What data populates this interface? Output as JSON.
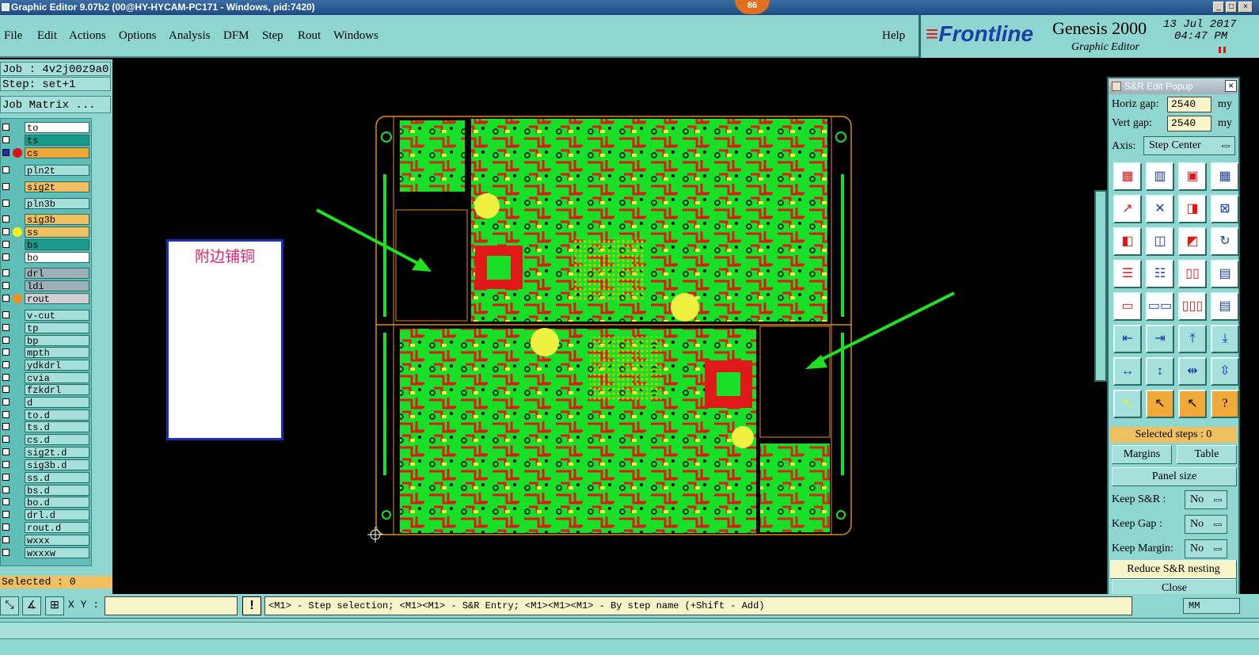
{
  "titlebar": {
    "title": "Graphic Editor 9.07b2 (00@HY-HYCAM-PC171 - Windows, pid:7420)",
    "badge": "86",
    "minimize": "_",
    "maximize": "□",
    "close": "×"
  },
  "menu": {
    "items": [
      "File",
      "Edit",
      "Actions",
      "Options",
      "Analysis",
      "DFM",
      "Step",
      "Rout",
      "Windows"
    ],
    "help": "Help"
  },
  "brand": {
    "logo": "Frontline",
    "product": "Genesis 2000",
    "subtitle": "Graphic Editor",
    "date": "13 Jul 2017",
    "time": "04:47 PM"
  },
  "left": {
    "job": "Job : 4v2j00z9a0",
    "step": "Step: set+1",
    "job_matrix": "Job Matrix ...",
    "selected": "Selected : 0"
  },
  "layers": [
    {
      "name": "to",
      "color": "#ffffff",
      "dot": ""
    },
    {
      "name": "ts",
      "color": "#1a9a8a",
      "dot": ""
    },
    {
      "name": "cs",
      "color": "#f0a838",
      "dot": "#e01010",
      "active": true
    },
    {
      "name": "pln2t",
      "color": "#a6e0da",
      "dot": ""
    },
    {
      "name": "sig2t",
      "color": "#f0c060",
      "dot": ""
    },
    {
      "name": "pln3b",
      "color": "#a6e0da",
      "dot": ""
    },
    {
      "name": "sig3b",
      "color": "#f0c060",
      "dot": ""
    },
    {
      "name": "ss",
      "color": "#f0c060",
      "dot": "#f0f020"
    },
    {
      "name": "bs",
      "color": "#1a9a8a",
      "dot": ""
    },
    {
      "name": "bo",
      "color": "#ffffff",
      "dot": ""
    },
    {
      "name": "drl",
      "color": "#a0b0b8",
      "dot": ""
    },
    {
      "name": "ldi",
      "color": "#a0b0b8",
      "dot": ""
    },
    {
      "name": "rout",
      "color": "#d0d0d0",
      "dot": "#f09020"
    },
    {
      "name": "v-cut",
      "color": "#a6e0da",
      "dot": ""
    },
    {
      "name": "tp",
      "color": "#a6e0da",
      "dot": ""
    },
    {
      "name": "bp",
      "color": "#a6e0da",
      "dot": ""
    },
    {
      "name": "mpth",
      "color": "#a6e0da",
      "dot": ""
    },
    {
      "name": "ydkdrl",
      "color": "#a6e0da",
      "dot": ""
    },
    {
      "name": "cvia",
      "color": "#a6e0da",
      "dot": ""
    },
    {
      "name": "fzkdrl",
      "color": "#a6e0da",
      "dot": ""
    },
    {
      "name": "d",
      "color": "#a6e0da",
      "dot": ""
    },
    {
      "name": "to.d",
      "color": "#a6e0da",
      "dot": ""
    },
    {
      "name": "ts.d",
      "color": "#a6e0da",
      "dot": ""
    },
    {
      "name": "cs.d",
      "color": "#a6e0da",
      "dot": ""
    },
    {
      "name": "sig2t.d",
      "color": "#a6e0da",
      "dot": ""
    },
    {
      "name": "sig3b.d",
      "color": "#a6e0da",
      "dot": ""
    },
    {
      "name": "ss.d",
      "color": "#a6e0da",
      "dot": ""
    },
    {
      "name": "bs.d",
      "color": "#a6e0da",
      "dot": ""
    },
    {
      "name": "bo.d",
      "color": "#a6e0da",
      "dot": ""
    },
    {
      "name": "drl.d",
      "color": "#a6e0da",
      "dot": ""
    },
    {
      "name": "rout.d",
      "color": "#a6e0da",
      "dot": ""
    },
    {
      "name": "wxxx",
      "color": "#a6e0da",
      "dot": ""
    },
    {
      "name": "wxxxw",
      "color": "#a6e0da",
      "dot": ""
    }
  ],
  "annotation": "附边铺铜",
  "bottom": {
    "xy_label": "X Y :",
    "xy_value": "",
    "warn": "!",
    "status": "<M1> - Step selection; <M1><M1> - S&R Entry; <M1><M1><M1> - By step name (+Shift - Add)",
    "units": "MM"
  },
  "popup": {
    "title": "S&R Edit Popup",
    "close": "×",
    "horiz_label": "Horiz gap:",
    "horiz_value": "2540",
    "vert_label": "Vert   gap:",
    "vert_value": "2540",
    "unit": "my",
    "axis_label": "Axis:",
    "axis_value": "Step Center",
    "selected_steps": "Selected steps : 0",
    "margins": "Margins",
    "table": "Table",
    "panel_size": "Panel size",
    "keep_sr_label": "Keep S&R  :",
    "keep_sr_value": "No",
    "keep_gap_label": "Keep Gap   :",
    "keep_gap_value": "No",
    "keep_margin_label": "Keep Margin:",
    "keep_margin_value": "No",
    "reduce": "Reduce S&R nesting",
    "close_btn": "Close"
  },
  "colors": {
    "panel": "#8fd6d0",
    "pcb_green": "#18e028",
    "pcb_red": "#e01818",
    "pcb_yellow": "#f0f040",
    "outline": "#e08a20",
    "arrow": "#20e020"
  }
}
